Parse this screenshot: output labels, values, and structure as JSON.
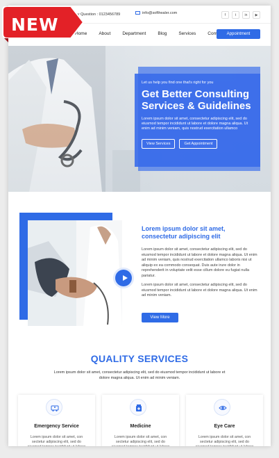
{
  "ribbon": {
    "label": "NEW"
  },
  "topbar": {
    "question": "Any Question : 0123456789",
    "email": "info@softhealer.com",
    "socials": [
      "f",
      "t",
      "in",
      "yt"
    ]
  },
  "nav": {
    "links": [
      "Home",
      "About",
      "Department",
      "Blog",
      "Services",
      "Contact"
    ],
    "appointment_label": "Appointment"
  },
  "hero": {
    "kicker": "Let us help you find one that's right for you",
    "title": "Get Better Consulting Services & Guidelines",
    "body": "Lorem ipsum dolor sit amet, consectetur adipiscing elit, sed do eiusmod tempor incididunt ut labore et dolore magna aliqua. Ut enim ad minim veniam, quis nostrud exercitation ullamco",
    "btn_services": "View Services",
    "btn_appointment": "Get Appointment"
  },
  "about": {
    "title": "Lorem ipsum dolor sit amet, consectetur adipiscing elit",
    "para1": "Lorem ipsum dolor sit amet, consectetur adipiscing elit, sed do eiusmod tempor incididunt ut labore et dolore magna aliqua. Ut enim ad minim veniam, quis nostrud exercitation ullamco laboris nisi ut aliquip ex ea commodo consequat. Duis aute irure dolor in reprehenderit in voluptate velit esse cillum dolore eu fugiat nulla pariatur.",
    "para2": "Lorem ipsum dolor sit amet, consectetur adipiscing elit, sed do eiusmod tempor incididunt ut labore et dolore magna aliqua. Ut enim ad minim veniam.",
    "btn_more": "View More"
  },
  "services": {
    "title": "QUALITY SERVICES",
    "subtitle": "Lorem ipsum dolor sit amet, consectetur adipiscing elit, sed do eiusmod tempor incididunt ut labore et dolore magna aliqua. Ut enim ad minim veniam.",
    "cards": [
      {
        "icon": "ambulance-icon",
        "title": "Emergency Service",
        "text": "Lorem ipsum dolor sit amet, con sectetur adipiscing elit, sed do eiusmod tempor incididunt ut labore"
      },
      {
        "icon": "medicine-icon",
        "title": "Medicine",
        "text": "Lorem ipsum dolor sit amet, con sectetur adipiscing elit, sed do eiusmod tempor incididunt ut labore"
      },
      {
        "icon": "eye-icon",
        "title": "Eye Care",
        "text": "Lorem ipsum dolor sit amet, con sectetur adipiscing elit, sed do eiusmod tempor incididunt ut labore"
      }
    ]
  },
  "colors": {
    "accent": "#2f6be6",
    "ribbon": "#e32127"
  }
}
